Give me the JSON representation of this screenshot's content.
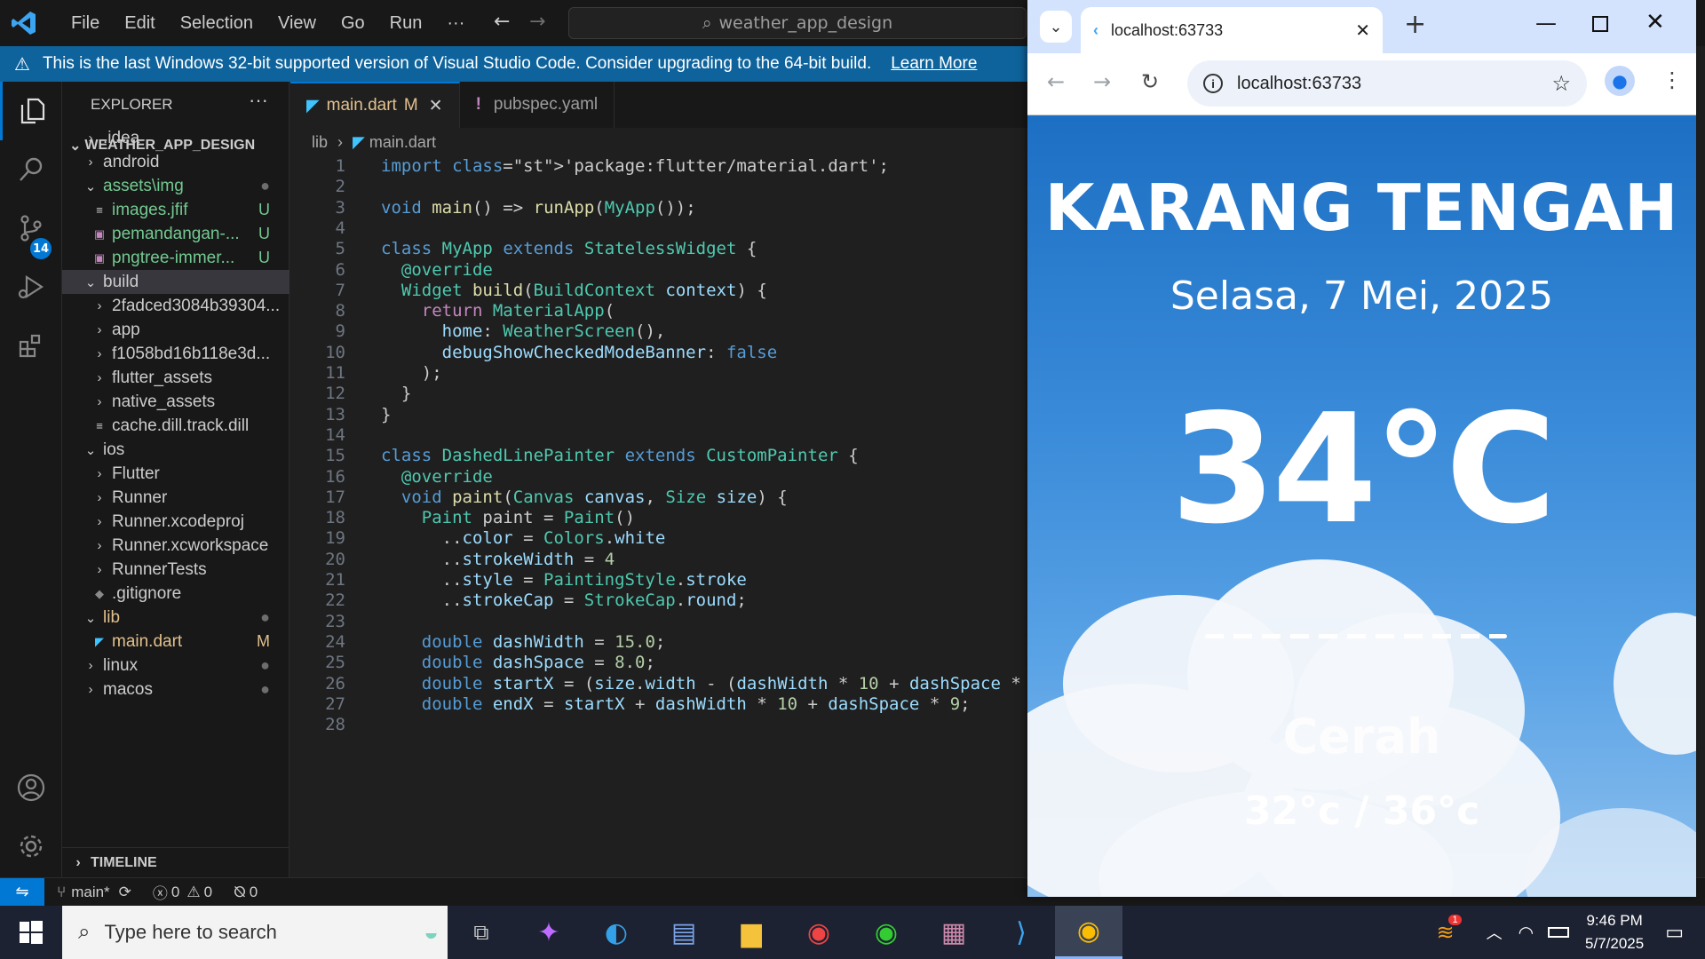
{
  "vscode": {
    "menu": [
      "File",
      "Edit",
      "Selection",
      "View",
      "Go",
      "Run",
      "···"
    ],
    "command_center": "weather_app_design",
    "banner": {
      "message": "This is the last Windows 32-bit supported version of Visual Studio Code. Consider upgrading to the 64-bit build.",
      "link": "Learn More"
    },
    "scm_badge": "14",
    "explorer": {
      "title": "EXPLORER",
      "more": "···",
      "root": "WEATHER_APP_DESIGN",
      "items": [
        {
          "label": ".idea",
          "indent": 1,
          "kind": "folder-closed",
          "status": ""
        },
        {
          "label": "android",
          "indent": 1,
          "kind": "folder-closed",
          "status": ""
        },
        {
          "label": "assets\\img",
          "indent": 1,
          "kind": "folder-open",
          "status": "●",
          "color": "git-u"
        },
        {
          "label": "images.jfif",
          "indent": 2,
          "kind": "file",
          "status": "U",
          "color": "git-u"
        },
        {
          "label": "pemandangan-...",
          "indent": 2,
          "kind": "image",
          "status": "U",
          "color": "git-u"
        },
        {
          "label": "pngtree-immer...",
          "indent": 2,
          "kind": "image",
          "status": "U",
          "color": "git-u"
        },
        {
          "label": "build",
          "indent": 1,
          "kind": "folder-open",
          "status": "",
          "selected": true
        },
        {
          "label": "2fadced3084b39304...",
          "indent": 2,
          "kind": "folder-closed",
          "status": ""
        },
        {
          "label": "app",
          "indent": 2,
          "kind": "folder-closed",
          "status": ""
        },
        {
          "label": "f1058bd16b118e3d...",
          "indent": 2,
          "kind": "folder-closed",
          "status": ""
        },
        {
          "label": "flutter_assets",
          "indent": 2,
          "kind": "folder-closed",
          "status": ""
        },
        {
          "label": "native_assets",
          "indent": 2,
          "kind": "folder-closed",
          "status": ""
        },
        {
          "label": "cache.dill.track.dill",
          "indent": 2,
          "kind": "file",
          "status": ""
        },
        {
          "label": "ios",
          "indent": 1,
          "kind": "folder-open",
          "status": ""
        },
        {
          "label": "Flutter",
          "indent": 2,
          "kind": "folder-closed",
          "status": ""
        },
        {
          "label": "Runner",
          "indent": 2,
          "kind": "folder-closed",
          "status": ""
        },
        {
          "label": "Runner.xcodeproj",
          "indent": 2,
          "kind": "folder-closed",
          "status": ""
        },
        {
          "label": "Runner.xcworkspace",
          "indent": 2,
          "kind": "folder-closed",
          "status": ""
        },
        {
          "label": "RunnerTests",
          "indent": 2,
          "kind": "folder-closed",
          "status": ""
        },
        {
          "label": ".gitignore",
          "indent": 2,
          "kind": "git",
          "status": ""
        },
        {
          "label": "lib",
          "indent": 1,
          "kind": "folder-open",
          "status": "●",
          "color": "git-m"
        },
        {
          "label": "main.dart",
          "indent": 2,
          "kind": "dart",
          "status": "M",
          "color": "git-m"
        },
        {
          "label": "linux",
          "indent": 1,
          "kind": "folder-closed",
          "status": "●"
        },
        {
          "label": "macos",
          "indent": 1,
          "kind": "folder-closed",
          "status": "●"
        }
      ],
      "timeline": "TIMELINE"
    },
    "tabs": [
      {
        "label": "main.dart",
        "badge": "M",
        "active": true
      },
      {
        "label": "pubspec.yaml",
        "badge": "",
        "active": false
      }
    ],
    "breadcrumb": [
      "lib",
      "main.dart"
    ],
    "code_lines": [
      "import 'package:flutter/material.dart';",
      "",
      "void main() => runApp(MyApp());",
      "",
      "class MyApp extends StatelessWidget {",
      "  @override",
      "  Widget build(BuildContext context) {",
      "    return MaterialApp(",
      "      home: WeatherScreen(),",
      "      debugShowCheckedModeBanner: false",
      "    );",
      "  }",
      "}",
      "",
      "class DashedLinePainter extends CustomPainter {",
      "  @override",
      "  void paint(Canvas canvas, Size size) {",
      "    Paint paint = Paint()",
      "      ..color = Colors.white",
      "      ..strokeWidth = 4",
      "      ..style = PaintingStyle.stroke",
      "      ..strokeCap = StrokeCap.round;",
      "",
      "    double dashWidth = 15.0;",
      "    double dashSpace = 8.0;",
      "    double startX = (size.width - (dashWidth * 10 + dashSpace *",
      "    double endX = startX + dashWidth * 10 + dashSpace * 9;",
      ""
    ],
    "status": {
      "branch": "main*",
      "errors": "0",
      "warnings": "0",
      "ports": "0"
    }
  },
  "chrome": {
    "tab_title": "localhost:63733",
    "url": "localhost:63733"
  },
  "weather": {
    "city": "KARANG TENGAH",
    "date": "Selasa, 7 Mei, 2025",
    "temperature": "34°C",
    "condition": "Cerah",
    "range": "32°c / 36°c"
  },
  "taskbar": {
    "search_placeholder": "Type here to search",
    "time": "9:46 PM",
    "date": "5/7/2025",
    "notif_count": "1"
  }
}
